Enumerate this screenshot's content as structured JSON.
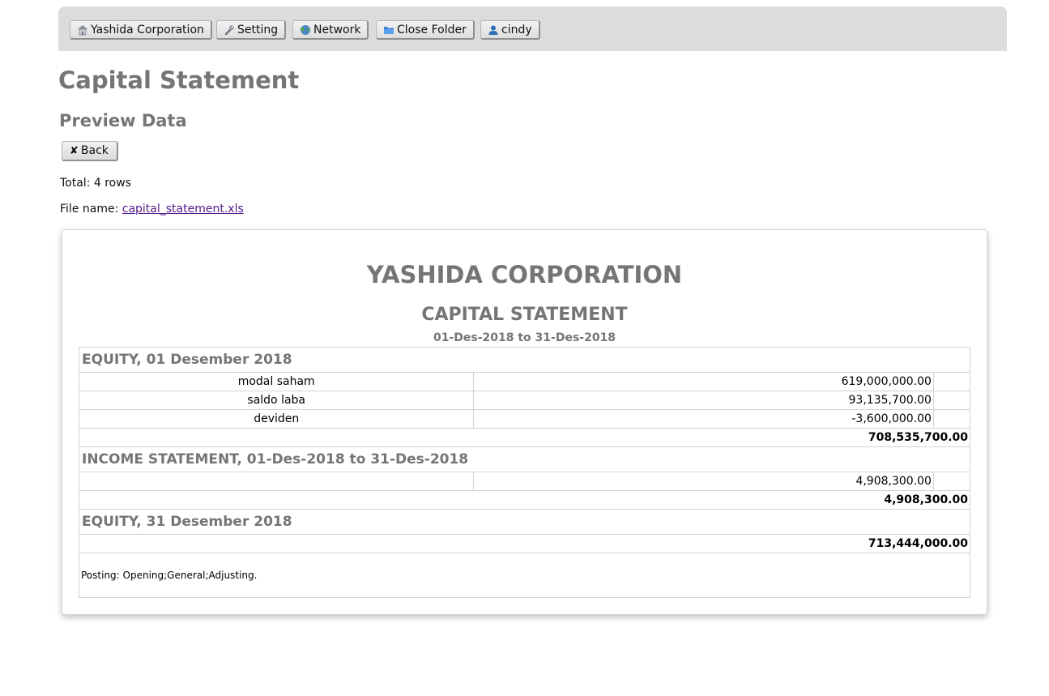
{
  "nav": {
    "items": [
      {
        "label": "Yashida Corporation",
        "icon": "house-icon"
      },
      {
        "label": "Setting",
        "icon": "wrench-icon"
      },
      {
        "label": "Network",
        "icon": "globe-icon"
      },
      {
        "label": "Close Folder",
        "icon": "folder-icon"
      },
      {
        "label": "cindy",
        "icon": "user-icon"
      }
    ]
  },
  "page": {
    "title": "Capital Statement",
    "subtitle": "Preview Data",
    "back_label": "Back",
    "total_text": "Total: 4 rows",
    "file_prefix": "File name: ",
    "file_name": "capital_statement.xls"
  },
  "report": {
    "company": "YASHIDA CORPORATION",
    "title": "CAPITAL STATEMENT",
    "period": "01-Des-2018 to 31-Des-2018",
    "sections": {
      "opening": {
        "heading": "EQUITY, 01 Desember 2018",
        "rows": [
          {
            "label": "modal saham",
            "amount": "619,000,000.00"
          },
          {
            "label": "saldo laba",
            "amount": "93,135,700.00"
          },
          {
            "label": "deviden",
            "amount": "-3,600,000.00"
          }
        ],
        "total": "708,535,700.00"
      },
      "income": {
        "heading": "INCOME STATEMENT, 01-Des-2018 to 31-Des-2018",
        "rows": [
          {
            "label": "",
            "amount": "4,908,300.00"
          }
        ],
        "total": "4,908,300.00"
      },
      "closing": {
        "heading": "EQUITY, 31 Desember 2018",
        "total": "713,444,000.00"
      }
    },
    "posting": "Posting: Opening;General;Adjusting."
  },
  "colors": {
    "heading_gray": "#757575",
    "topbar_bg": "#dcdcdc",
    "link": "#551a8b"
  }
}
